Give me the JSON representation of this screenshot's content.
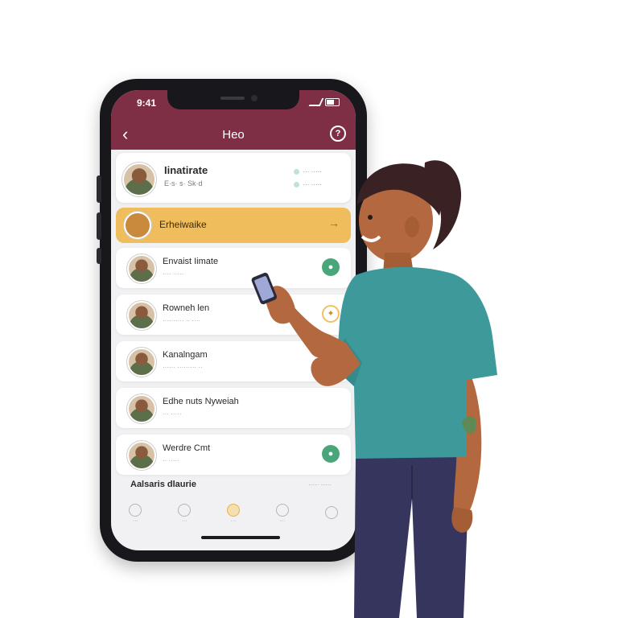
{
  "status_bar": {
    "time": "9:41"
  },
  "header": {
    "title": "Heo",
    "back_icon": "chevron-left-icon",
    "help_icon": "help-icon"
  },
  "profile": {
    "name": "Iinatirate",
    "subtitle": "E·s· s· Sk·d",
    "meta": [
      "··· ·····",
      "··· ·····"
    ]
  },
  "highlight": {
    "label": "Erheiwaike",
    "icon": "arrow-right-icon"
  },
  "list": [
    {
      "name": "Envaist Iimate",
      "sub": "···· ·····",
      "action": "green"
    },
    {
      "name": "Rowneh len",
      "sub": "·········· ·· ····",
      "action": "gold"
    },
    {
      "name": "Kanalngam",
      "sub": "······ ········· ··",
      "action": "none"
    },
    {
      "name": "Edhe nuts Nyweiah",
      "sub": "··· ·····",
      "action": "none"
    },
    {
      "name": "Werdre Cmt",
      "sub": "·· ·····",
      "action": "green"
    }
  ],
  "section": {
    "title": "Aalsaris dlaurie",
    "link": "·····  ·····"
  },
  "tabs": [
    {
      "label": "···",
      "active": false
    },
    {
      "label": "···",
      "active": false
    },
    {
      "label": "···",
      "active": true
    },
    {
      "label": "···",
      "active": false
    },
    {
      "label": "",
      "active": false
    }
  ],
  "colors": {
    "header": "#7e2f45",
    "highlight": "#f0bd5d",
    "accent_green": "#49a57a",
    "shirt": "#3e9a9a",
    "jeans": "#35355e"
  }
}
